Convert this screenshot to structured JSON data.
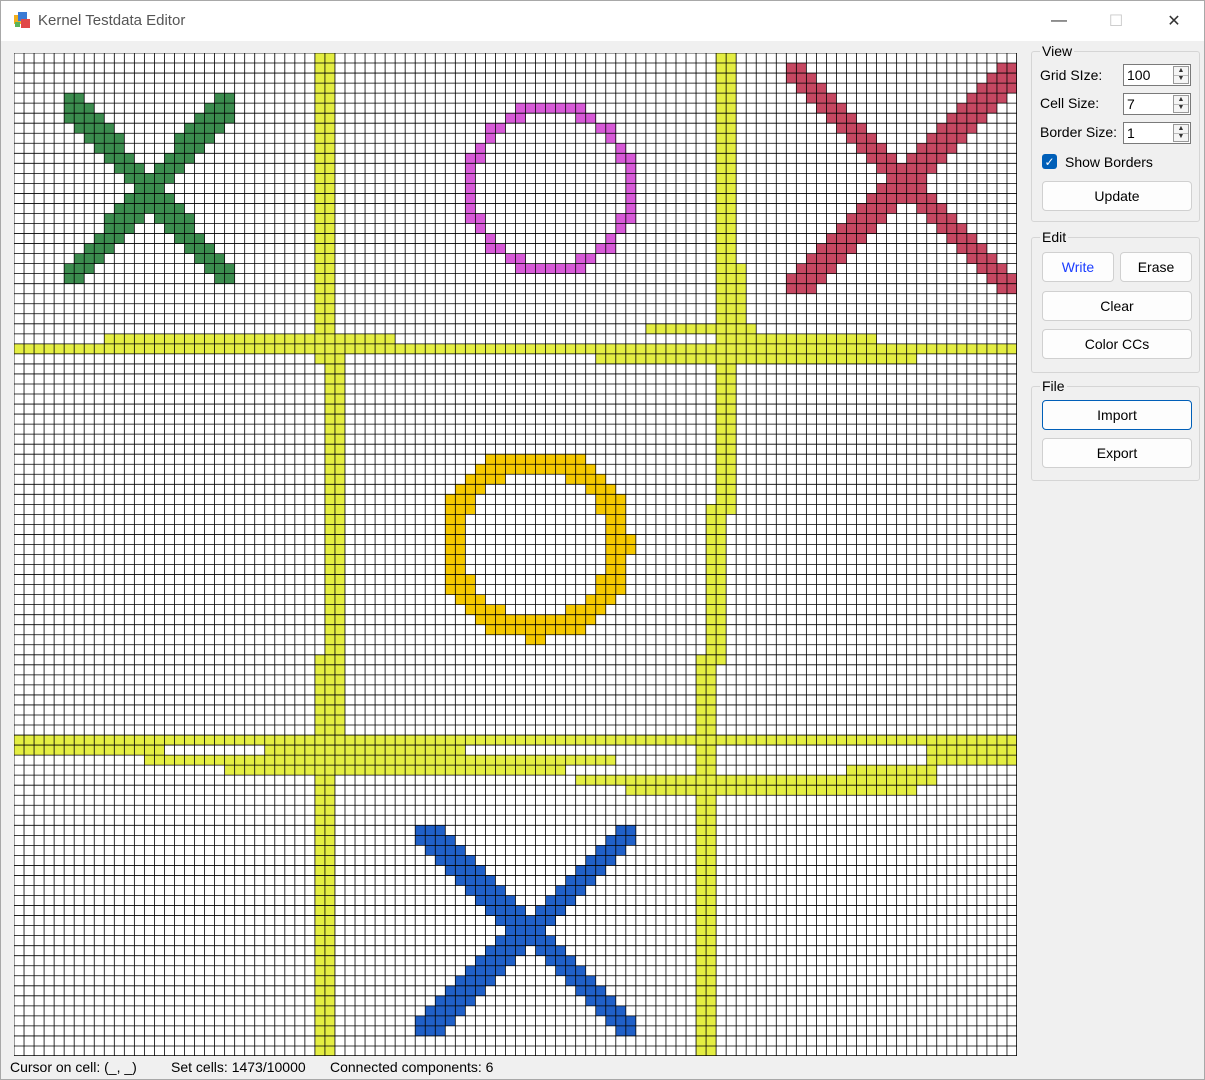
{
  "window": {
    "title": "Kernel Testdata Editor",
    "controls": {
      "minimize": "—",
      "maximize": "☐",
      "close": "✕"
    }
  },
  "view": {
    "legend": "View",
    "grid_size_label": "Grid SIze:",
    "grid_size_value": "100",
    "cell_size_label": "Cell Size:",
    "cell_size_value": "7",
    "border_size_label": "Border Size:",
    "border_size_value": "1",
    "show_borders_label": "Show Borders",
    "show_borders_checked": true,
    "update_label": "Update"
  },
  "edit": {
    "legend": "Edit",
    "write_label": "Write",
    "erase_label": "Erase",
    "clear_label": "Clear",
    "color_ccs_label": "Color CCs"
  },
  "file": {
    "legend": "File",
    "import_label": "Import",
    "export_label": "Export"
  },
  "status": {
    "cursor": "Cursor on cell: (_, _)",
    "set_cells": "Set cells: 1473/10000",
    "components": "Connected components: 6"
  },
  "grid": {
    "grid_size": 100,
    "line_color": "#000000",
    "background": "#ffffff",
    "components": [
      {
        "name": "green-x",
        "color": "#3b8c4e",
        "shape": "x",
        "cells": {
          "c1": 6,
          "r1": 5,
          "c2": 21,
          "r2": 22
        }
      },
      {
        "name": "magenta-o",
        "color": "#d85ad8",
        "shape": "o",
        "cells": {
          "c1": 45,
          "r1": 5,
          "c2": 61,
          "r2": 21
        }
      },
      {
        "name": "red-x",
        "color": "#c64862",
        "shape": "x",
        "cells": {
          "c1": 78,
          "r1": 2,
          "c2": 99,
          "r2": 23
        }
      },
      {
        "name": "yellow-o",
        "color": "#f5c800",
        "shape": "o",
        "cells": {
          "c1": 43,
          "r1": 40,
          "c2": 60,
          "r2": 57
        }
      },
      {
        "name": "blue-x",
        "color": "#2060c8",
        "shape": "x",
        "cells": {
          "c1": 41,
          "r1": 78,
          "c2": 61,
          "r2": 97
        }
      },
      {
        "name": "yellow-lines",
        "color": "#e4ee42",
        "shape": "hash"
      }
    ]
  }
}
